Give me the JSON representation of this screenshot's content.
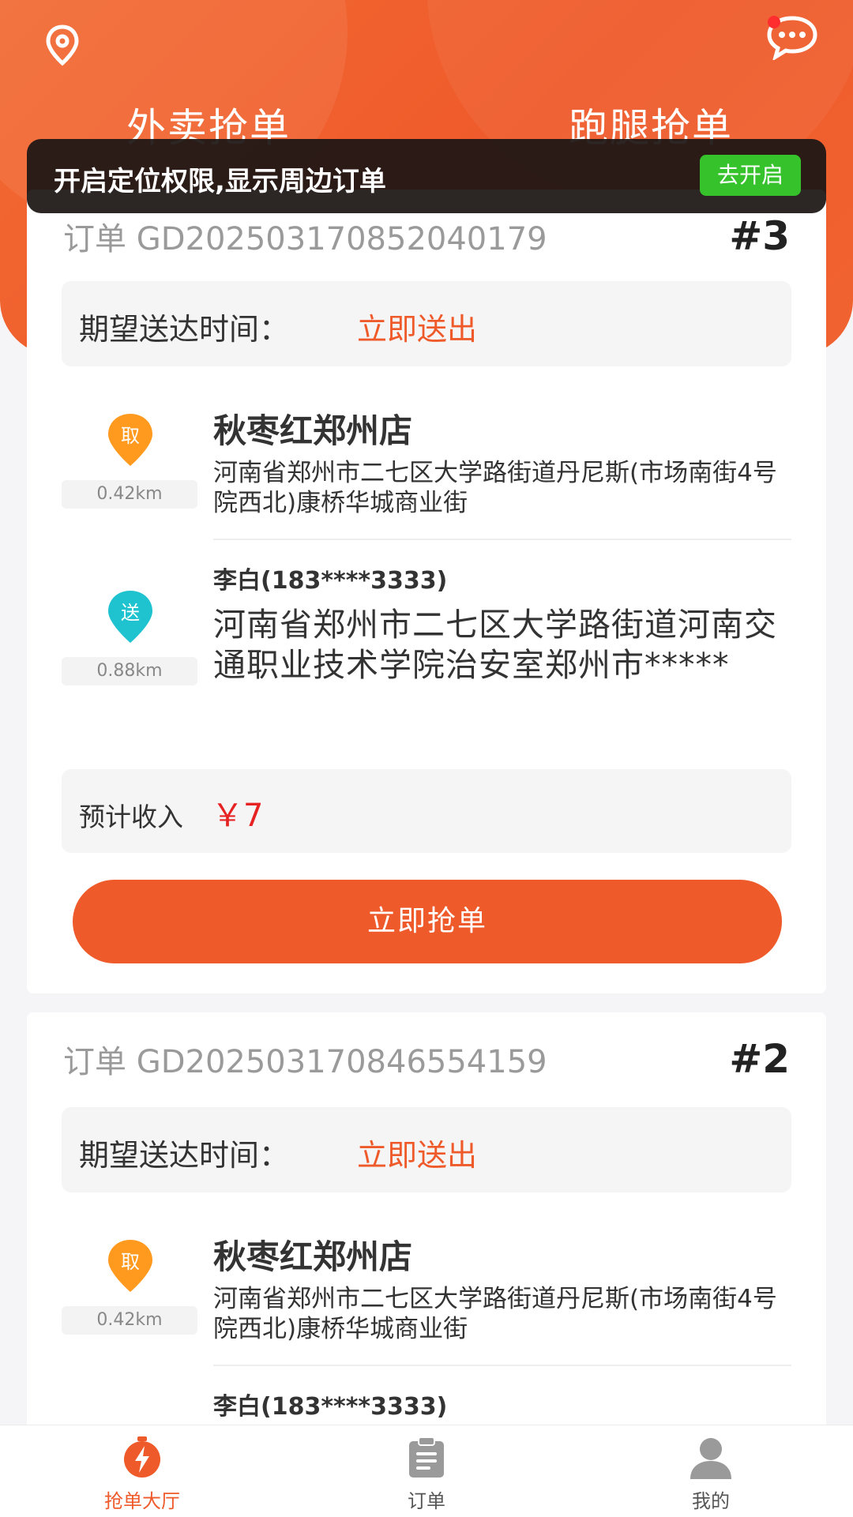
{
  "header": {
    "tabs": [
      {
        "label": "外卖抢单"
      },
      {
        "label": "跑腿抢单"
      }
    ]
  },
  "toast": {
    "text": "开启定位权限,显示周边订单",
    "button": "去开启"
  },
  "orders": [
    {
      "order_no": "订单 GD20250317085204017​9",
      "seq": "#3",
      "time_label": "期望送达时间：",
      "time_value": "立即送出",
      "pickup_badge": "取",
      "pickup_distance": "0.42km",
      "shop_name": "秋枣红郑州店",
      "shop_address": "河南省郑州市二七区大学路街道丹尼斯(市场南街4号院西北)康桥华城商业街",
      "deliver_badge": "送",
      "deliver_distance": "0.88km",
      "receiver": "李白(183****3333)",
      "receiver_address": "河南省郑州市二七区大学路街道河南交通职业技术学院治安室郑州市*****",
      "income_label": "预计收入",
      "income_value": "￥7",
      "grab_button": "立即抢单"
    },
    {
      "order_no": "订单 GD20250317084655415​9",
      "seq": "#2",
      "time_label": "期望送达时间：",
      "time_value": "立即送出",
      "pickup_badge": "取",
      "pickup_distance": "0.42km",
      "shop_name": "秋枣红郑州店",
      "shop_address": "河南省郑州市二七区大学路街道丹尼斯(市场南街4号院西北)康桥华城商业街",
      "receiver": "李白(183****3333)"
    }
  ],
  "tabbar": {
    "items": [
      {
        "label": "抢单大厅"
      },
      {
        "label": "订单"
      },
      {
        "label": "我的"
      }
    ]
  },
  "colors": {
    "brand": "#ef5a2b",
    "pickup": "#ff9a1f",
    "deliver": "#1ec3cf",
    "toast_button": "#35c22b",
    "income": "#e62222"
  }
}
